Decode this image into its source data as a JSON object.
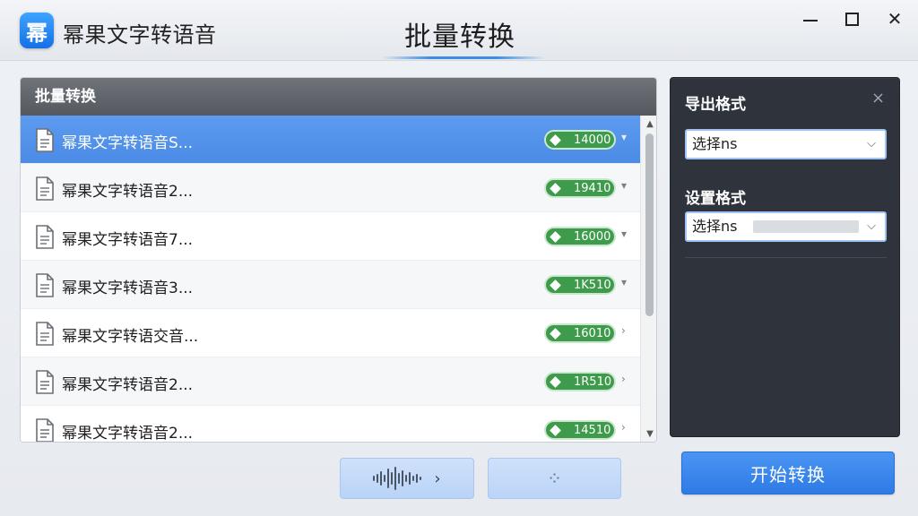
{
  "app": {
    "logo_char": "幂",
    "title": "幂果文字转语音",
    "page_title": "批量转换"
  },
  "window_controls": {
    "close_glyph": "✕"
  },
  "list": {
    "header": "批量转换",
    "rows": [
      {
        "label": "幂果文字转语音S...",
        "badge": "14000",
        "arrow": "▾",
        "selected": true
      },
      {
        "label": "幂果文字转语音2...",
        "badge": "19410",
        "arrow": "▾",
        "selected": false
      },
      {
        "label": "幂果文字转语音7...",
        "badge": "16000",
        "arrow": "▾",
        "selected": false
      },
      {
        "label": "幂果文字转语音3...",
        "badge": "1K510",
        "arrow": "▾",
        "selected": false
      },
      {
        "label": "幂果文字转语交音...",
        "badge": "16010",
        "arrow": "›",
        "selected": false
      },
      {
        "label": "幂果文字转语音2...",
        "badge": "1R510",
        "arrow": "›",
        "selected": false
      },
      {
        "label": "幂果文字转语音2...",
        "badge": "14510",
        "arrow": "›",
        "selected": false
      }
    ]
  },
  "buttons": {
    "wave_arrow": "›",
    "loading_glyph": "⁘",
    "start": "开始转换"
  },
  "settings": {
    "export_format_label": "导出格式",
    "export_format_value": "选择ns",
    "set_format_label": "设置格式",
    "set_format_value": "选择ns",
    "close_glyph": "×",
    "caret": "⌵"
  },
  "colors": {
    "accent": "#4b8be6",
    "badge_green": "#3e9b4c",
    "panel_dark": "#2f343c"
  }
}
